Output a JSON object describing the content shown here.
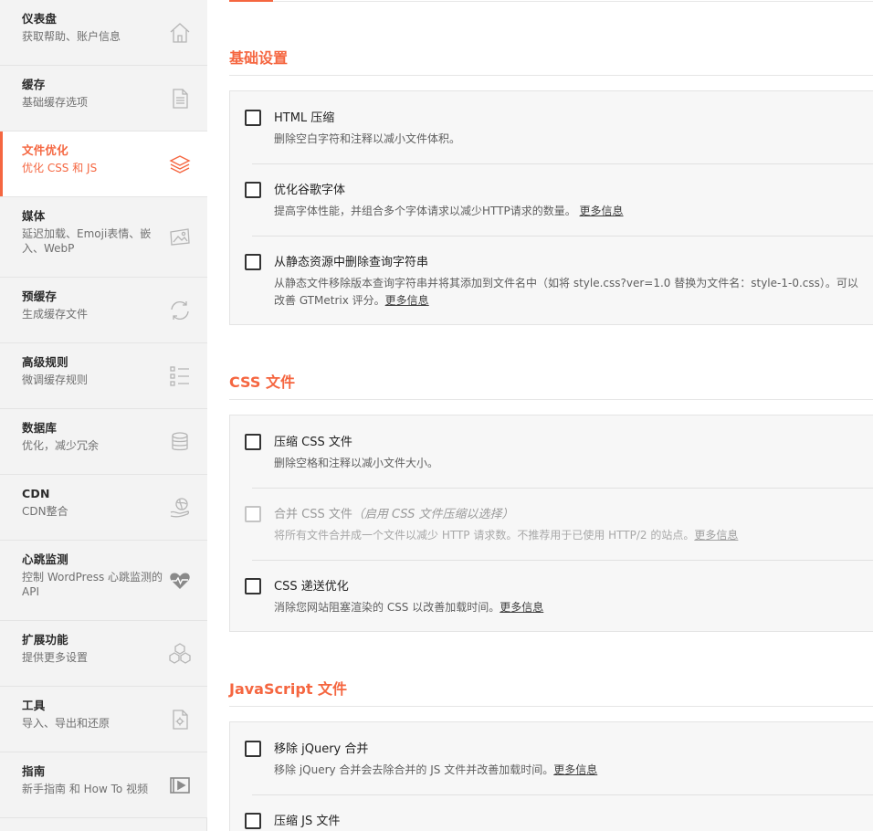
{
  "sidebar": {
    "items": [
      {
        "title": "仪表盘",
        "sub": "获取帮助、账户信息",
        "icon": "home-icon"
      },
      {
        "title": "缓存",
        "sub": "基础缓存选项",
        "icon": "document-icon"
      },
      {
        "title": "文件优化",
        "sub": "优化 CSS 和 JS",
        "icon": "layers-icon",
        "active": true
      },
      {
        "title": "媒体",
        "sub": "延迟加载、Emoji表情、嵌入、WebP",
        "icon": "image-icon"
      },
      {
        "title": "预缓存",
        "sub": "生成缓存文件",
        "icon": "refresh-icon"
      },
      {
        "title": "高级规则",
        "sub": "微调缓存规则",
        "icon": "checklist-icon"
      },
      {
        "title": "数据库",
        "sub": "优化，减少冗余",
        "icon": "database-icon"
      },
      {
        "title": "CDN",
        "sub": "CDN整合",
        "icon": "cdn-icon"
      },
      {
        "title": "心跳监测",
        "sub": "控制 WordPress 心跳监测的 API",
        "icon": "heartbeat-icon"
      },
      {
        "title": "扩展功能",
        "sub": "提供更多设置",
        "icon": "cubes-icon"
      },
      {
        "title": "工具",
        "sub": "导入、导出和还原",
        "icon": "file-gear-icon"
      },
      {
        "title": "指南",
        "sub": "新手指南 和 How To 视频",
        "icon": "video-icon"
      }
    ]
  },
  "main": {
    "sections": [
      {
        "title": "基础设置",
        "options": [
          {
            "label": "HTML 压缩",
            "desc": "删除空白字符和注释以减小文件体积。",
            "checked": false
          },
          {
            "label": "优化谷歌字体",
            "desc": "提高字体性能，并组合多个字体请求以减少HTTP请求的数量。",
            "link": "更多信息",
            "checked": false
          },
          {
            "label": "从静态资源中删除查询字符串",
            "desc": "从静态文件移除版本查询字符串并将其添加到文件名中（如将 style.css?ver=1.0 替换为文件名：style-1-0.css）。可以改善 GTMetrix 评分。",
            "link": "更多信息",
            "checked": false
          }
        ]
      },
      {
        "title": "CSS 文件",
        "options": [
          {
            "label": "压缩 CSS 文件",
            "desc": "删除空格和注释以减小文件大小。",
            "checked": false
          },
          {
            "label": "合并 CSS 文件",
            "hint": "（启用 CSS 文件压缩以选择）",
            "desc": "将所有文件合并成一个文件以减少 HTTP 请求数。不推荐用于已使用 HTTP/2 的站点。",
            "link": "更多信息",
            "checked": false,
            "disabled": true
          },
          {
            "label": "CSS 递送优化",
            "desc": "消除您网站阻塞渲染的 CSS 以改善加载时间。",
            "link": "更多信息",
            "checked": false
          }
        ]
      },
      {
        "title": "JavaScript 文件",
        "options": [
          {
            "label": "移除 jQuery 合并",
            "desc": "移除 jQuery 合并会去除合并的 JS 文件并改善加载时间。",
            "link": "更多信息",
            "checked": false
          },
          {
            "label": "压缩 JS 文件",
            "checked": false
          }
        ]
      }
    ]
  }
}
